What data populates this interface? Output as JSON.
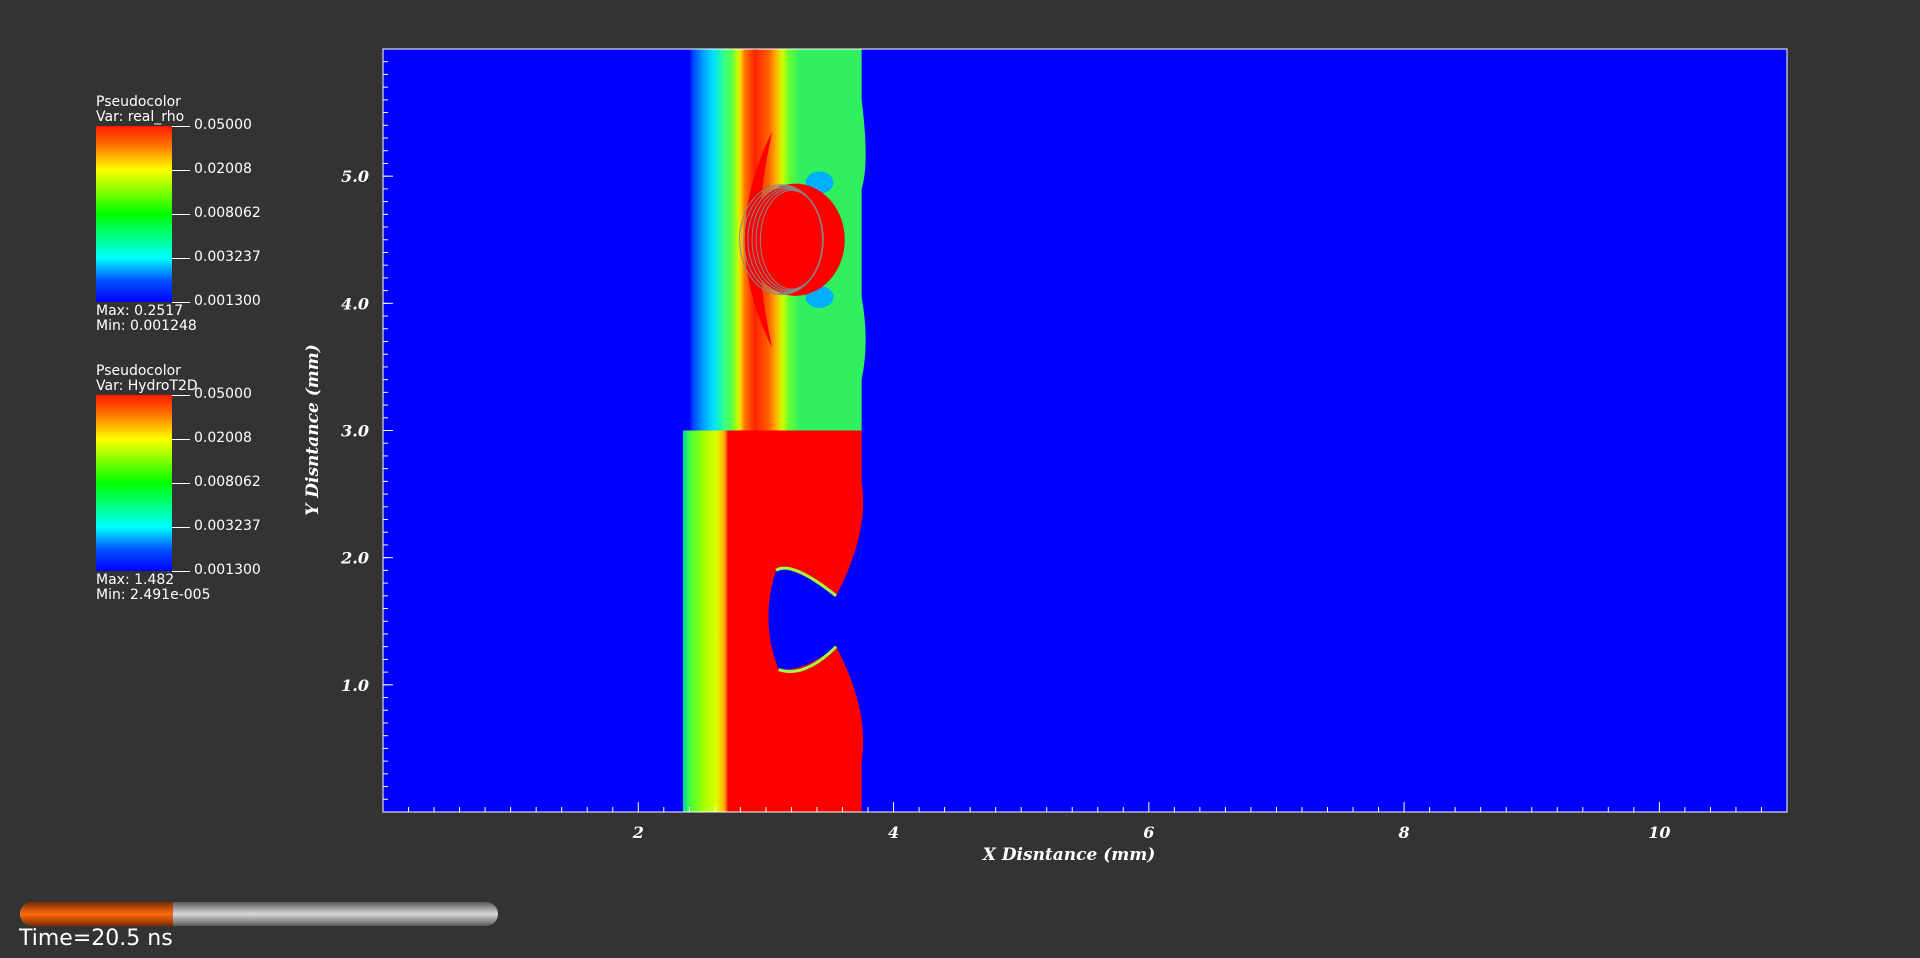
{
  "legends": [
    {
      "plot_type": "Pseudocolor",
      "var_label": "Var: real_rho",
      "tick_labels": [
        "0.05000",
        "0.02008",
        "0.008062",
        "0.003237",
        "0.001300"
      ],
      "max_label": "Max:  0.2517",
      "min_label": "Min:  0.001248"
    },
    {
      "plot_type": "Pseudocolor",
      "var_label": "Var: HydroT2D",
      "tick_labels": [
        "0.05000",
        "0.02008",
        "0.008062",
        "0.003237",
        "0.001300"
      ],
      "max_label": "Max:  1.482",
      "min_label": "Min:  2.491e-005"
    }
  ],
  "colors": {
    "background": "#333333",
    "low": "#0000ff",
    "high": "#ff0000",
    "progress_fill": "#ff6a10"
  },
  "time": {
    "label": "Time=20.5 ns",
    "progress": 0.32
  },
  "chart_data": {
    "type": "heatmap",
    "xlabel": "X Disntance (mm)",
    "ylabel": "Y Disntance (mm)",
    "xlim": [
      0,
      11
    ],
    "ylim": [
      0,
      6
    ],
    "x_ticks": [
      2,
      4,
      6,
      8,
      10
    ],
    "x_tick_labels": [
      "2",
      "4",
      "6",
      "8",
      "10"
    ],
    "y_ticks": [
      1.0,
      2.0,
      3.0,
      4.0,
      5.0
    ],
    "y_tick_labels": [
      "1.0",
      "2.0",
      "3.0",
      "4.0",
      "5.0"
    ],
    "grid": false,
    "colormap": "rainbow (blue-cyan-green-yellow-red), log scale",
    "upper_region": {
      "variable": "real_rho",
      "y_range": [
        3.0,
        6.0
      ],
      "features": {
        "cyan_band_x": [
          2.4,
          2.75
        ],
        "orange_band_x": [
          2.75,
          3.25
        ],
        "green_region_x": [
          3.25,
          3.75
        ],
        "blob_center": [
          3.2,
          4.5
        ],
        "blob_radius": 0.42,
        "front_x": 3.75
      }
    },
    "lower_region": {
      "variable": "HydroT2D",
      "y_range": [
        0.0,
        3.0
      ],
      "features": {
        "green_band_x": [
          2.35,
          2.7
        ],
        "red_region_x": [
          2.7,
          3.75
        ],
        "cavity_center": [
          3.0,
          1.5
        ],
        "front_x": 3.75
      }
    }
  }
}
